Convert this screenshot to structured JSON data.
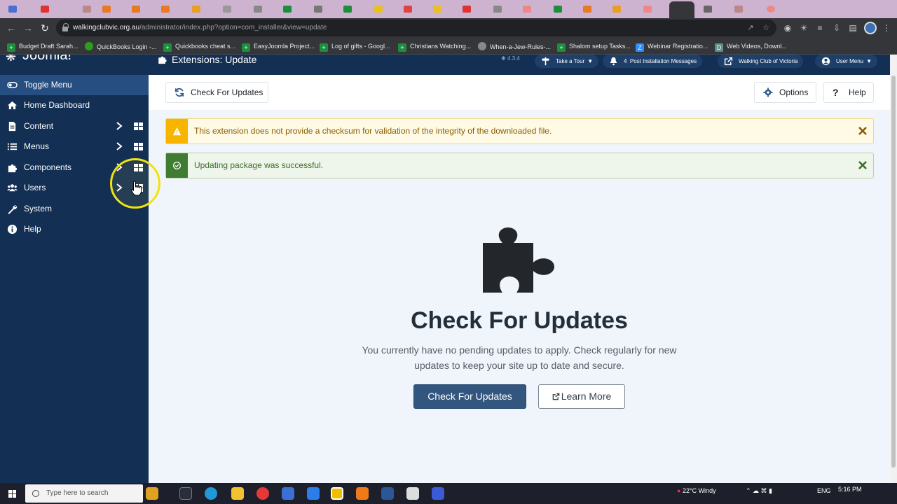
{
  "browser": {
    "url_domain": "walkingclubvic.org.au",
    "url_path": "/administrator/index.php?option=com_installer&view=update",
    "bookmarks": [
      {
        "label": "Budget Draft Sarah...",
        "icon": "plus-icon",
        "color": "#1e8e3e"
      },
      {
        "label": "QuickBooks Login -...",
        "icon": "quickbooks-icon",
        "color": "#2ca01c"
      },
      {
        "label": "Quickbooks cheat s...",
        "icon": "plus-icon",
        "color": "#1e8e3e"
      },
      {
        "label": "EasyJoomla Project...",
        "icon": "plus-icon",
        "color": "#1e8e3e"
      },
      {
        "label": "Log of gifts - Googl...",
        "icon": "plus-icon",
        "color": "#1e8e3e"
      },
      {
        "label": "Christians Watching...",
        "icon": "plus-icon",
        "color": "#1e8e3e"
      },
      {
        "label": "When-a-Jew-Rules-...",
        "icon": "globe-icon",
        "color": "#888888"
      },
      {
        "label": "Shalom setup Tasks...",
        "icon": "plus-icon",
        "color": "#1e8e3e"
      },
      {
        "label": "Webinar Registratio...",
        "icon": "zoom-icon",
        "color": "#2d8cff"
      },
      {
        "label": "Web Videos, Downl...",
        "icon": "doc-icon",
        "color": "#5f8f8f"
      }
    ]
  },
  "sidebar": {
    "logo": "Joomla!",
    "toggle_label": "Toggle Menu",
    "items": [
      {
        "label": "Home Dashboard",
        "icon": "home-icon"
      },
      {
        "label": "Content",
        "icon": "file-icon"
      },
      {
        "label": "Menus",
        "icon": "list-icon"
      },
      {
        "label": "Components",
        "icon": "puzzle-icon"
      },
      {
        "label": "Users",
        "icon": "users-icon"
      },
      {
        "label": "System",
        "icon": "wrench-icon"
      },
      {
        "label": "Help",
        "icon": "info-icon"
      }
    ]
  },
  "header": {
    "title": "Extensions: Update",
    "version": "4.3.4",
    "take_tour": "Take a Tour",
    "notifications_count": "4",
    "post_install": "Post Installation Messages",
    "site_name": "Walking Club of Victoria",
    "user_menu": "User Menu"
  },
  "toolbar": {
    "check_updates": "Check For Updates",
    "options": "Options",
    "help": "Help"
  },
  "alerts": {
    "warning": "This extension does not provide a checksum for validation of the integrity of the downloaded file.",
    "success": "Updating package was successful."
  },
  "empty_state": {
    "title": "Check For Updates",
    "text": "You currently have no pending updates to apply. Check regularly for new updates to keep your site up to date and secure.",
    "primary_button": "Check For Updates",
    "secondary_button": "Learn More"
  },
  "taskbar": {
    "search_placeholder": "Type here to search",
    "weather": "22°C  Windy",
    "language": "ENG",
    "time": "5:16 PM"
  },
  "colors": {
    "sidebar_bg": "#132f53",
    "sidebar_active": "#264e81",
    "primary_button": "#33567f",
    "warning": "#f7b500",
    "success": "#3f7c32"
  }
}
